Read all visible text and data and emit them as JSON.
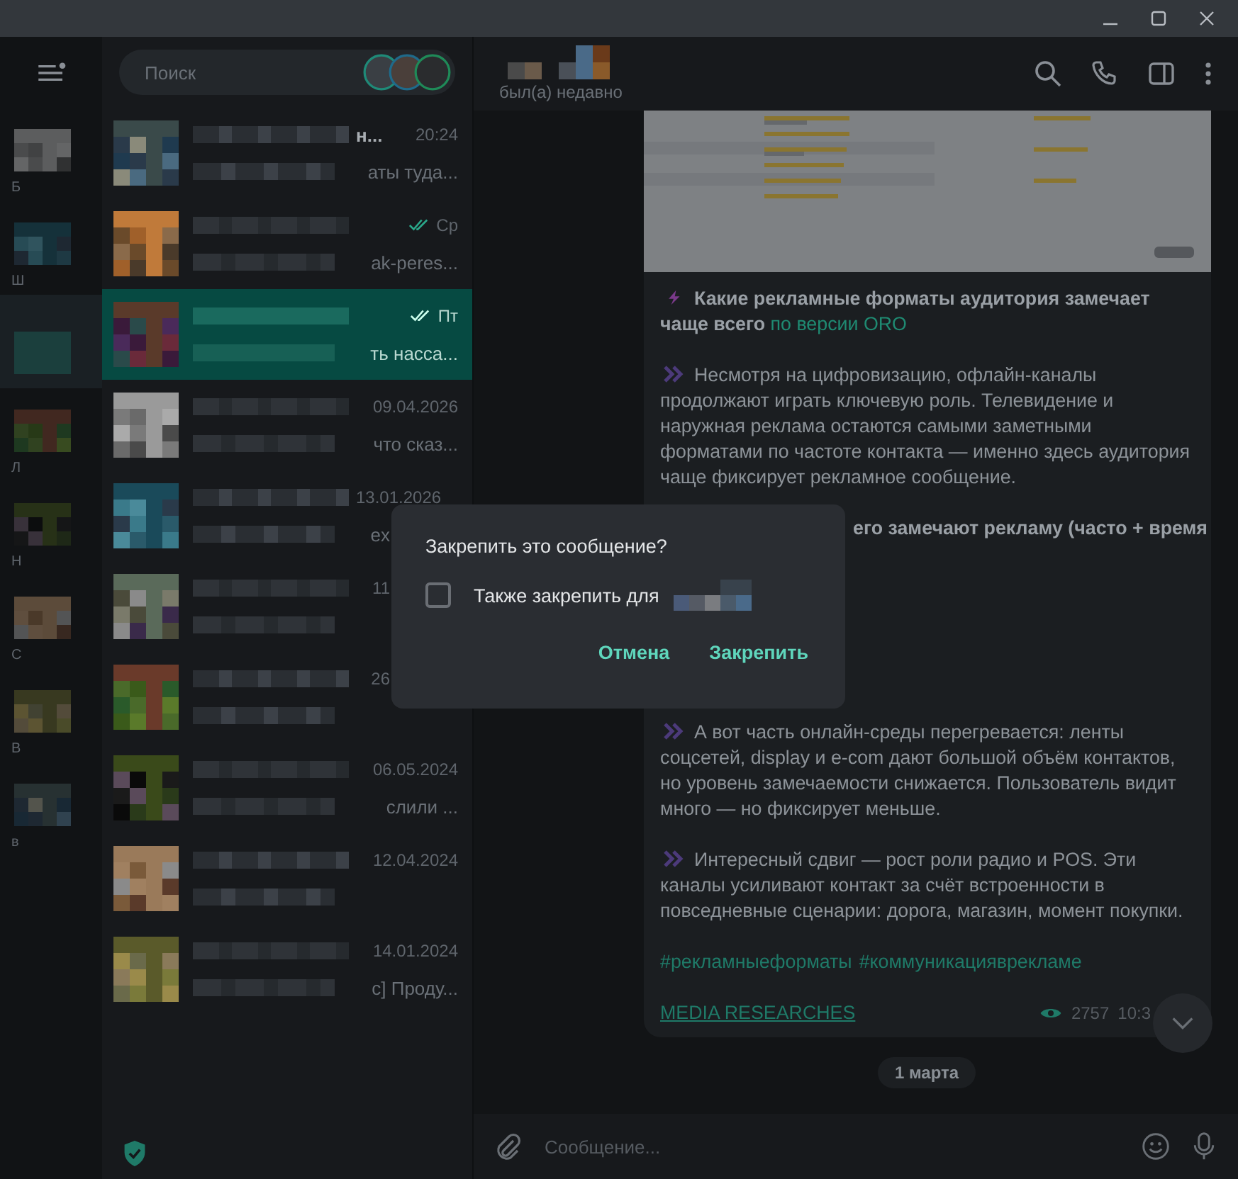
{
  "folders": [
    {
      "label": "Б",
      "selected": false
    },
    {
      "label": "Ш",
      "selected": false
    },
    {
      "selected": true
    },
    {
      "label": "Л",
      "selected": false
    },
    {
      "label": "Н",
      "selected": false
    },
    {
      "label": "С",
      "selected": false
    },
    {
      "label": "В",
      "selected": false
    },
    {
      "label": "в",
      "selected": false
    }
  ],
  "search": {
    "placeholder": "Поиск"
  },
  "chats": [
    {
      "title": "н...",
      "time": "20:24",
      "preview": "аты туда...",
      "selected": false,
      "read": false
    },
    {
      "time": "Ср",
      "preview": "ak-peres...",
      "selected": false,
      "read": true
    },
    {
      "time": "Пт",
      "preview": "ть насса...",
      "selected": true,
      "read": true
    },
    {
      "time": "09.04.2026",
      "preview": "что сказ...",
      "selected": false,
      "read": false
    },
    {
      "time": "13.01.2026",
      "preview": "ex",
      "selected": false,
      "read": false
    },
    {
      "time": "11",
      "selected": false,
      "read": false
    },
    {
      "time": "26",
      "selected": false,
      "read": false
    },
    {
      "time": "06.05.2024",
      "preview": "слили ...",
      "selected": false,
      "read": false
    },
    {
      "time": "12.04.2024",
      "selected": false,
      "read": false
    },
    {
      "time": "14.01.2024",
      "preview": "c] Проду...",
      "selected": false,
      "read": false
    }
  ],
  "header": {
    "status": "был(а) недавно"
  },
  "message": {
    "image": {
      "kind": "picture"
    },
    "heading": "Какие рекламные форматы аудитория замечает чаще всего",
    "heading_link": "по версии ORO",
    "paragraphs": [
      "Несмотря на цифровизацию, офлайн-каналы продолжают играть ключевую роль. Телевидение и наружная реклама остаются самыми заметными форматами по частоте контакта — именно здесь аудитория чаще фиксирует рекламное сообщение."
    ],
    "partial_line": "его замечают рекламу (часто + время",
    "paragraphs_after": [
      "А вот часть онлайн-среды перегревается: ленты соцсетей, display и e-com дают большой объём контактов, но уровень замечаемости снижается. Пользователь видит много — но фиксирует меньше.",
      "Интересный сдвиг — рост роли радио и POS. Эти каналы усиливают контакт за счёт встроенности в повседневные сценарии: дорога, магазин, момент покупки."
    ],
    "hashtags": [
      "#рекламныеформаты",
      "#коммуникацияврекламе"
    ],
    "signature": "MEDIA RESEARCHES",
    "views": "2757",
    "time": "10:3"
  },
  "date_pill": "1 марта",
  "composer": {
    "placeholder": "Сообщение..."
  },
  "dialog": {
    "title": "Закрепить это сообщение?",
    "option": {
      "label": "Также закрепить для",
      "checked": false
    },
    "buttons": [
      "Отмена",
      "Закрепить"
    ]
  }
}
